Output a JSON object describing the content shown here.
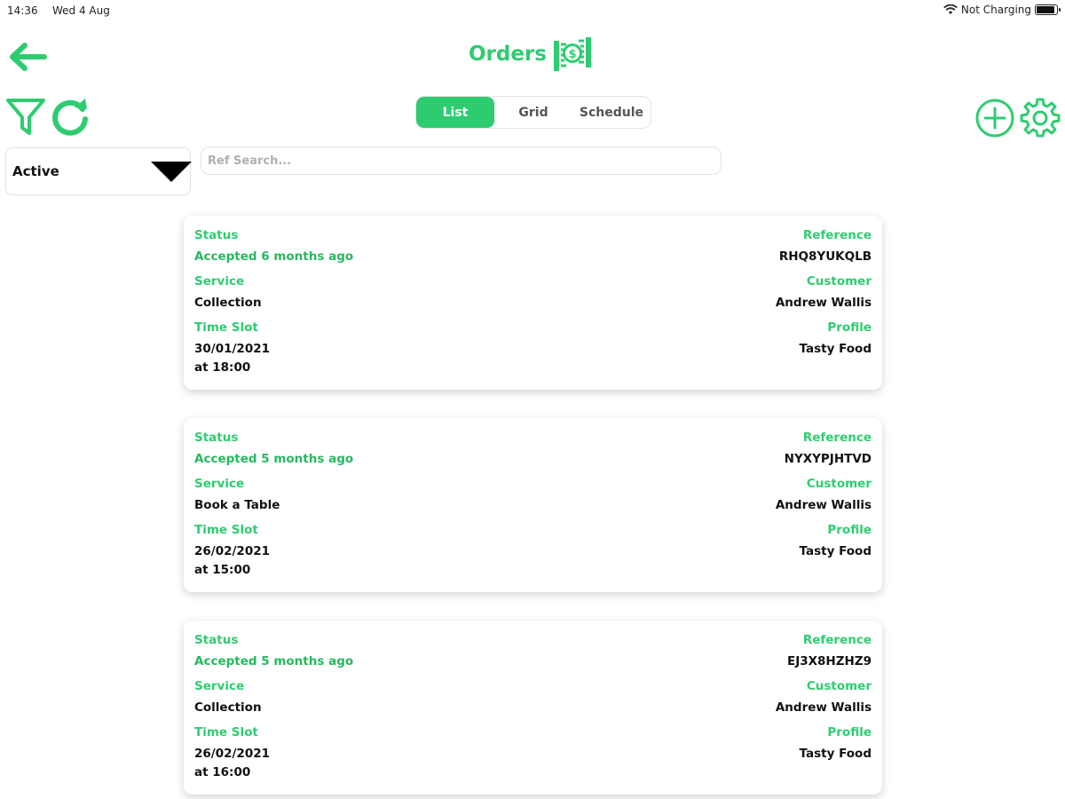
{
  "status_bar": {
    "time": "14:36",
    "date": "Wed 4 Aug",
    "charging": "Not Charging",
    "battery_level": 0.9
  },
  "header": {
    "back_icon": "arrow-left-icon",
    "title": "Orders",
    "title_icon": "money-stack-icon"
  },
  "toolbar": {
    "filter_icon": "filter-icon",
    "refresh_icon": "refresh-icon",
    "add_icon": "add-circle-icon",
    "settings_icon": "gear-icon",
    "view_tabs": [
      {
        "label": "List",
        "active": true
      },
      {
        "label": "Grid",
        "active": false
      },
      {
        "label": "Schedule",
        "active": false
      }
    ]
  },
  "filters": {
    "status_value": "Active",
    "ref_search_placeholder": "Ref Search..."
  },
  "labels": {
    "status": "Status",
    "service": "Service",
    "time_slot": "Time Slot",
    "reference": "Reference",
    "customer": "Customer",
    "profile": "Profile"
  },
  "orders": [
    {
      "status": "Accepted 6 months ago",
      "service": "Collection",
      "date": "30/01/2021",
      "time": "at 18:00",
      "reference": "RHQ8YUKQLB",
      "customer": "Andrew Wallis",
      "profile": "Tasty Food"
    },
    {
      "status": "Accepted 5 months ago",
      "service": "Book a Table",
      "date": "26/02/2021",
      "time": "at 15:00",
      "reference": "NYXYPJHTVD",
      "customer": "Andrew Wallis",
      "profile": "Tasty Food"
    },
    {
      "status": "Accepted 5 months ago",
      "service": "Collection",
      "date": "26/02/2021",
      "time": "at 16:00",
      "reference": "EJ3X8HZHZ9",
      "customer": "Andrew Wallis",
      "profile": "Tasty Food"
    }
  ],
  "colors": {
    "accent": "#2ecc71",
    "status_text": "#27b85f",
    "text": "#111111"
  }
}
